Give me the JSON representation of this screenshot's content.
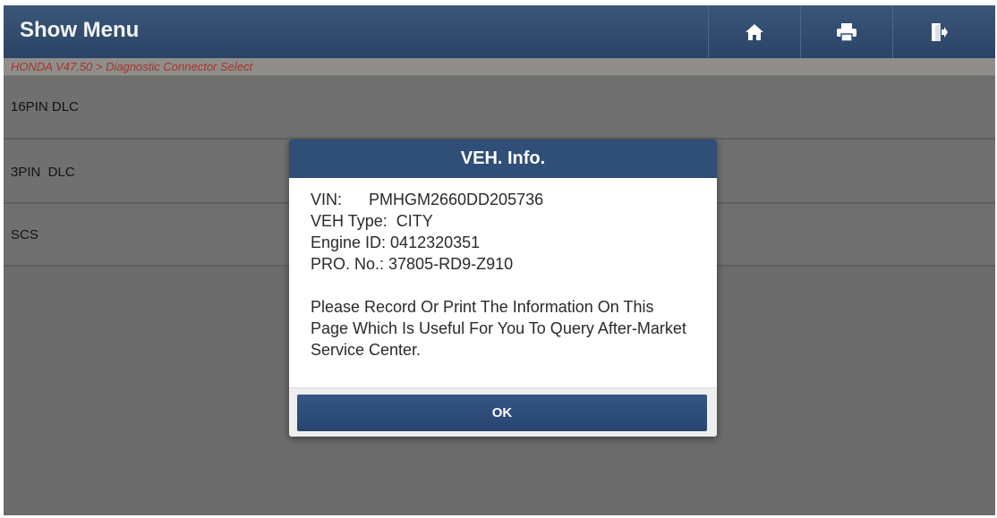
{
  "header": {
    "title": "Show Menu",
    "icons": [
      "home-icon",
      "print-icon",
      "exit-icon"
    ]
  },
  "breadcrumb": "HONDA V47.50 > Diagnostic Connector Select",
  "connectors": {
    "items": [
      "16PIN DLC",
      "3PIN  DLC",
      "SCS"
    ]
  },
  "dialog": {
    "title": "VEH. Info.",
    "vin_label": "VIN:",
    "vin_value": "PMHGM2660DD205736",
    "type_line": "VEH Type:  CITY",
    "engine_line": "Engine ID: 0412320351",
    "pro_line": "PRO. No.: 37805-RD9-Z910",
    "notice": "Please Record Or Print The Information On This Page Which Is Useful For You To Query After-Market Service Center.",
    "ok_label": "OK"
  },
  "colors": {
    "titlebar": "#2f4e78",
    "breadcrumb_text": "#a8322c",
    "backdrop": "#6e6e6e"
  }
}
